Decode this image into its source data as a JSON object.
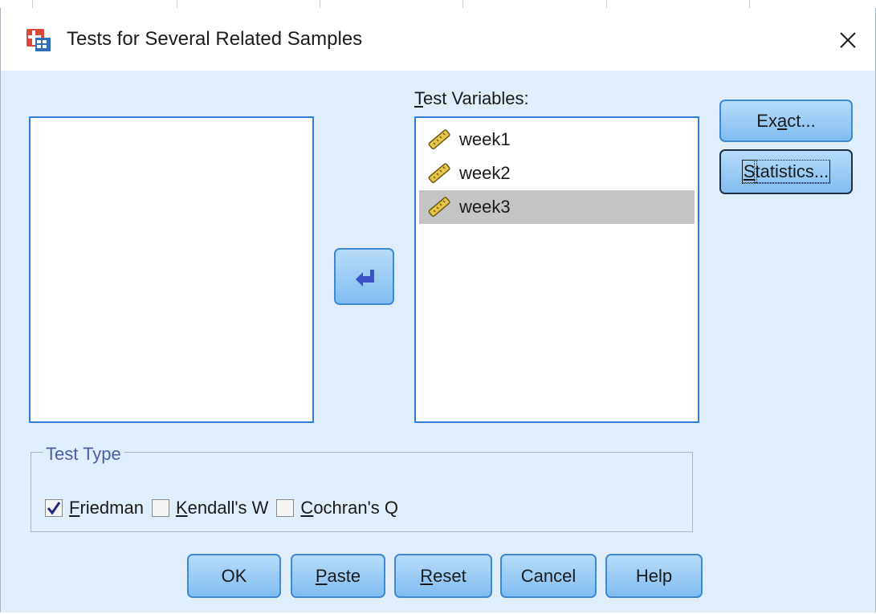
{
  "window": {
    "title": "Tests for Several Related Samples",
    "close_symbol": "✕"
  },
  "source_list": {
    "items": []
  },
  "target_list": {
    "label_mnemonic": "T",
    "label_rest": "est Variables:",
    "items": [
      {
        "name": "week1",
        "icon": "scale-ruler-icon",
        "selected": false
      },
      {
        "name": "week2",
        "icon": "scale-ruler-icon",
        "selected": false
      },
      {
        "name": "week3",
        "icon": "scale-ruler-icon",
        "selected": true
      }
    ]
  },
  "side_buttons": {
    "exact": {
      "pre": "Ex",
      "mnemonic": "a",
      "post": "ct..."
    },
    "statistics": {
      "mnemonic": "S",
      "post": "tatistics..."
    }
  },
  "test_type": {
    "legend": "Test Type",
    "options": [
      {
        "mnemonic": "F",
        "rest": "riedman",
        "checked": true
      },
      {
        "mnemonic": "K",
        "rest": "endall's W",
        "checked": false
      },
      {
        "mnemonic": "C",
        "rest": "ochran's Q",
        "checked": false
      }
    ]
  },
  "bottom_buttons": {
    "ok": {
      "pre": "OK",
      "mnemonic": "",
      "post": ""
    },
    "paste": {
      "pre": "",
      "mnemonic": "P",
      "post": "aste"
    },
    "reset": {
      "pre": "",
      "mnemonic": "R",
      "post": "eset"
    },
    "cancel": {
      "pre": "Cancel",
      "mnemonic": "",
      "post": ""
    },
    "help": {
      "pre": "Help",
      "mnemonic": "",
      "post": ""
    }
  },
  "colors": {
    "dialog_bg": "#dfeefa",
    "button_blue": "#7fbdf1",
    "list_border": "#2f7ed8",
    "selected_item": "#c4c4c4",
    "legend_text": "#4a5ea8",
    "check_mark": "#1f2a7a"
  }
}
